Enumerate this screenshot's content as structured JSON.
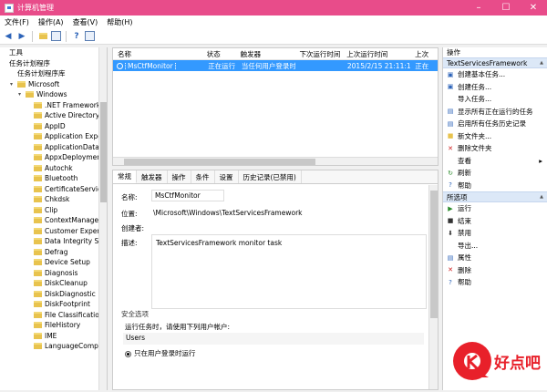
{
  "window": {
    "title": "计算机管理"
  },
  "menu": [
    "文件(F)",
    "操作(A)",
    "查看(V)",
    "帮助(H)"
  ],
  "tree": {
    "items": [
      {
        "label": "工具",
        "indent": 0,
        "expander": ""
      },
      {
        "label": "任务计划程序",
        "indent": 0,
        "expander": ""
      },
      {
        "label": "任务计划程序库",
        "indent": 1,
        "expander": ""
      },
      {
        "label": "Microsoft",
        "indent": 1,
        "expander": "▾"
      },
      {
        "label": "Windows",
        "indent": 2,
        "expander": "▾"
      },
      {
        "label": ".NET Framework",
        "indent": 3,
        "expander": ""
      },
      {
        "label": "Active Directory",
        "indent": 3,
        "expander": ""
      },
      {
        "label": "AppID",
        "indent": 3,
        "expander": ""
      },
      {
        "label": "Application Expe",
        "indent": 3,
        "expander": ""
      },
      {
        "label": "ApplicationData",
        "indent": 3,
        "expander": ""
      },
      {
        "label": "AppxDeploymen",
        "indent": 3,
        "expander": ""
      },
      {
        "label": "Autochk",
        "indent": 3,
        "expander": ""
      },
      {
        "label": "Bluetooth",
        "indent": 3,
        "expander": ""
      },
      {
        "label": "CertificateService",
        "indent": 3,
        "expander": ""
      },
      {
        "label": "Chkdsk",
        "indent": 3,
        "expander": ""
      },
      {
        "label": "Clip",
        "indent": 3,
        "expander": ""
      },
      {
        "label": "ContextManager",
        "indent": 3,
        "expander": ""
      },
      {
        "label": "Customer Experi",
        "indent": 3,
        "expander": ""
      },
      {
        "label": "Data Integrity Sc",
        "indent": 3,
        "expander": ""
      },
      {
        "label": "Defrag",
        "indent": 3,
        "expander": ""
      },
      {
        "label": "Device Setup",
        "indent": 3,
        "expander": ""
      },
      {
        "label": "Diagnosis",
        "indent": 3,
        "expander": ""
      },
      {
        "label": "DiskCleanup",
        "indent": 3,
        "expander": ""
      },
      {
        "label": "DiskDiagnostic",
        "indent": 3,
        "expander": ""
      },
      {
        "label": "DiskFootprint",
        "indent": 3,
        "expander": ""
      },
      {
        "label": "File Classification",
        "indent": 3,
        "expander": ""
      },
      {
        "label": "FileHistory",
        "indent": 3,
        "expander": ""
      },
      {
        "label": "IME",
        "indent": 3,
        "expander": ""
      },
      {
        "label": "LanguageCompo",
        "indent": 3,
        "expander": ""
      }
    ]
  },
  "task_list": {
    "columns": [
      "名称",
      "状态",
      "触发器",
      "下次运行时间",
      "上次运行时间",
      "上次"
    ],
    "row": {
      "name": "MsCtfMonitor",
      "status": "正在运行",
      "trigger": "当任何用户登录时",
      "next_run": "",
      "last_run": "2015/2/15 21:11:16",
      "last_result": "正在"
    }
  },
  "details": {
    "tabs": [
      "常规",
      "触发器",
      "操作",
      "条件",
      "设置",
      "历史记录(已禁用)"
    ],
    "name_label": "名称:",
    "name_value": "MsCtfMonitor",
    "location_label": "位置:",
    "location_value": "\\Microsoft\\Windows\\TextServicesFramework",
    "author_label": "创建者:",
    "desc_label": "描述:",
    "desc_value": "TextServicesFramework monitor task",
    "security_title": "安全选项",
    "run_as_text": "运行任务时，请使用下列用户帐户:",
    "user": "Users",
    "radio_label": "只在用户登录时运行"
  },
  "actions": {
    "header": "操作",
    "section1": "TextServicesFramework",
    "items1": [
      {
        "label": "创建基本任务...",
        "icon": "create-basic-task-icon"
      },
      {
        "label": "创建任务...",
        "icon": "create-task-icon"
      },
      {
        "label": "导入任务...",
        "icon": ""
      },
      {
        "label": "显示所有正在运行的任务",
        "icon": "running-tasks-icon"
      },
      {
        "label": "启用所有任务历史记录",
        "icon": "history-icon"
      },
      {
        "label": "新文件夹...",
        "icon": "new-folder-icon"
      },
      {
        "label": "删除文件夹",
        "icon": "delete-folder-icon"
      },
      {
        "label": "查看",
        "icon": ""
      },
      {
        "label": "刷新",
        "icon": "refresh-icon"
      },
      {
        "label": "帮助",
        "icon": "help-icon"
      }
    ],
    "section2": "所选项",
    "items2": [
      {
        "label": "运行",
        "icon": "run-icon"
      },
      {
        "label": "结束",
        "icon": "end-icon"
      },
      {
        "label": "禁用",
        "icon": "disable-icon"
      },
      {
        "label": "导出...",
        "icon": ""
      },
      {
        "label": "属性",
        "icon": "properties-icon"
      },
      {
        "label": "删除",
        "icon": "delete-icon"
      },
      {
        "label": "帮助",
        "icon": "help-icon"
      }
    ]
  },
  "watermark": {
    "text": "好点吧"
  },
  "colors": {
    "titlebar": "#e84c8a",
    "selection": "#3399ff",
    "section": "#dce8f7",
    "watermark": "#e8202a"
  }
}
